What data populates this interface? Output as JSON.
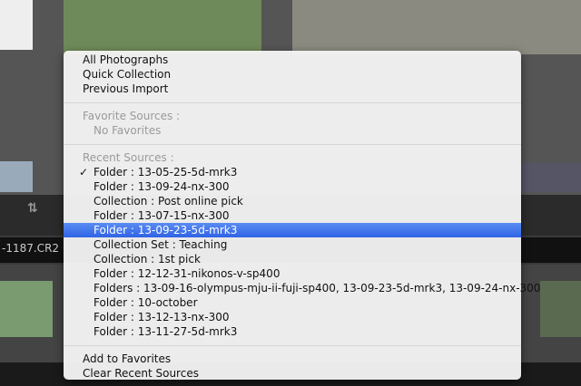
{
  "filename": "-1187.CR2",
  "menu": {
    "top": [
      "All Photographs",
      "Quick Collection",
      "Previous Import"
    ],
    "favorites_header": "Favorite Sources :",
    "no_favorites": "No Favorites",
    "recent_header": "Recent Sources :",
    "checkmark": "✓",
    "recent": [
      "Folder : 13-05-25-5d-mrk3",
      "Folder : 13-09-24-nx-300",
      "Collection : Post online pick",
      "Folder : 13-07-15-nx-300",
      "Folder : 13-09-23-5d-mrk3",
      "Collection Set : Teaching",
      "Collection : 1st pick",
      "Folder : 12-12-31-nikonos-v-sp400",
      "Folders : 13-09-16-olympus-mju-ii-fuji-sp400, 13-09-23-5d-mrk3, 13-09-24-nx-300",
      "Folder : 10-october",
      "Folder : 13-12-13-nx-300",
      "Folder : 13-11-27-5d-mrk3"
    ],
    "checked_index": 0,
    "highlighted_index": 4,
    "bottom": [
      "Add to Favorites",
      "Clear Recent Sources"
    ]
  },
  "colors": {
    "highlight": "#3a6fe9",
    "background": "#3a3a3a"
  }
}
